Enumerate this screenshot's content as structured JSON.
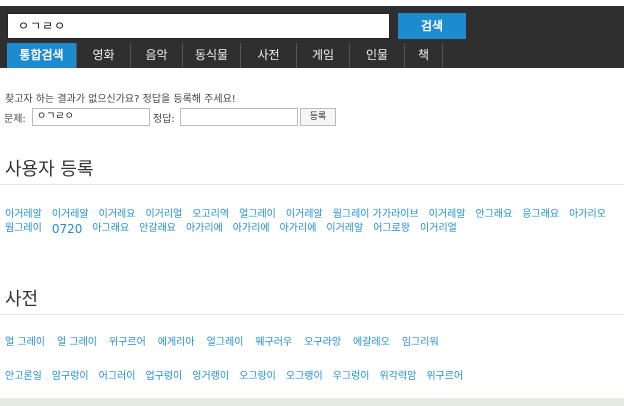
{
  "search": {
    "query": "ㅇㄱㄹㅇ",
    "button_label": "검색"
  },
  "tabs": [
    {
      "label": "통합검색",
      "active": true
    },
    {
      "label": "영화",
      "active": false
    },
    {
      "label": "음악",
      "active": false
    },
    {
      "label": "동식물",
      "active": false
    },
    {
      "label": "사전",
      "active": false
    },
    {
      "label": "게임",
      "active": false
    },
    {
      "label": "인물",
      "active": false
    },
    {
      "label": "책",
      "active": false
    }
  ],
  "register_form": {
    "prompt": "찾고자 하는 결과가 없으신가요? 정답을 등록해 주세요!",
    "question_label": "문제:",
    "question_value": "ㅇㄱㄹㅇ",
    "answer_label": "정답:",
    "answer_value": "",
    "submit_label": "등록"
  },
  "user_section": {
    "title": "사용자 등록",
    "items": [
      "이거레알",
      "이거레알",
      "이거레요",
      "이거리얼",
      "오고리역",
      "얼그레이",
      "이거레알",
      "웜그레이 가가라이브",
      "이거레알",
      "안그래요",
      "응그래요",
      "아가리오",
      "웜그레이",
      "0720",
      "아그래요",
      "안갈래요",
      "아가리에",
      "아가리에",
      "아가리에",
      "이거레알",
      "어그로왕",
      "이거리얼"
    ]
  },
  "dict_section": {
    "title": "사전",
    "row1": [
      "얼 그레이",
      "얼 그레이",
      "위구르어",
      "에게리아",
      "얼그레이",
      "웨구러우",
      "오구라앙",
      "에갈레오",
      "임그리워"
    ],
    "row2": [
      "안고론일",
      "암구렁이",
      "어그러이",
      "업구렁이",
      "엉거랭이",
      "오그랑이",
      "오그랭이",
      "우그렁이",
      "위각력암",
      "위구르어"
    ]
  }
}
